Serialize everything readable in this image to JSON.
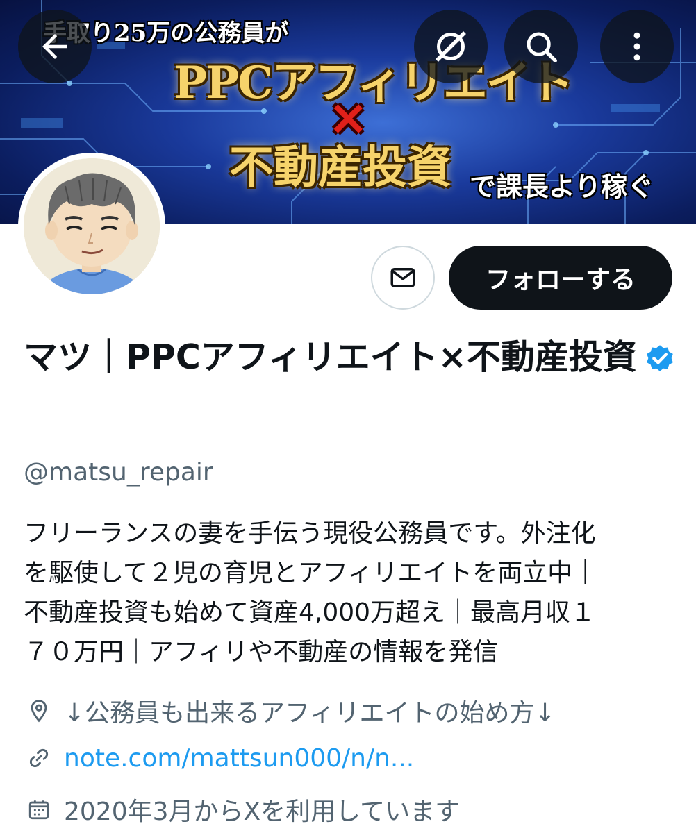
{
  "banner": {
    "subtitle": "手取り25万の公務員が",
    "title_line1": "PPCアフィリエイト",
    "times": "×",
    "title_line2": "不動産投資",
    "tail": "で課長より稼ぐ"
  },
  "top_bar": {
    "back_icon": "arrow-left-icon",
    "grok_icon": "grok-icon",
    "search_icon": "search-icon",
    "more_icon": "more-vertical-icon"
  },
  "profile": {
    "display_name": "マツ｜PPCアフィリエイト×不動産投資",
    "verified": true,
    "handle": "@matsu_repair",
    "follow_label": "フォローする",
    "message_icon": "mail-icon",
    "bio": "フリーランスの妻を手伝う現役公務員です。外注化\nを駆使して２児の育児とアフィリエイトを両立中｜\n不動産投資も始めて資産4,000万超え｜最高月収１\n７０万円｜アフィリや不動産の情報を発信",
    "location": "↓公務員も出来るアフィリエイトの始め方↓",
    "website": "note.com/mattsun000/n/n...",
    "joined": "2020年3月からXを利用しています"
  },
  "colors": {
    "text_primary": "#0f1419",
    "text_secondary": "#536471",
    "link": "#1d9bf0",
    "verified": "#1d9bf0",
    "follow_bg": "#0f1419"
  }
}
